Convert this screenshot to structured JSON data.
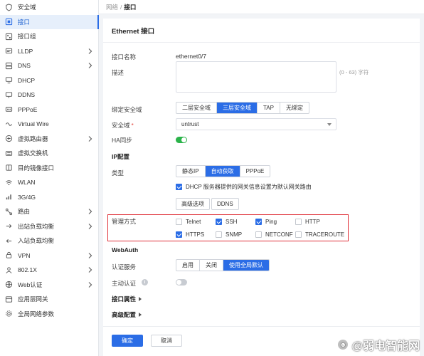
{
  "sidebar": {
    "items": [
      {
        "label": "安全域",
        "icon": "shield-icon",
        "has_children": false,
        "active": false
      },
      {
        "label": "接口",
        "icon": "interface-icon",
        "has_children": false,
        "active": true
      },
      {
        "label": "接口组",
        "icon": "interface-group-icon",
        "has_children": false,
        "active": false
      },
      {
        "label": "LLDP",
        "icon": "lldp-icon",
        "has_children": true,
        "active": false
      },
      {
        "label": "DNS",
        "icon": "dns-icon",
        "has_children": true,
        "active": false
      },
      {
        "label": "DHCP",
        "icon": "dhcp-icon",
        "has_children": false,
        "active": false
      },
      {
        "label": "DDNS",
        "icon": "ddns-icon",
        "has_children": false,
        "active": false
      },
      {
        "label": "PPPoE",
        "icon": "pppoe-icon",
        "has_children": false,
        "active": false
      },
      {
        "label": "Virtual Wire",
        "icon": "virtual-wire-icon",
        "has_children": false,
        "active": false
      },
      {
        "label": "虚拟路由器",
        "icon": "virtual-router-icon",
        "has_children": true,
        "active": false
      },
      {
        "label": "虚拟交换机",
        "icon": "virtual-switch-icon",
        "has_children": false,
        "active": false
      },
      {
        "label": "目的镜像接口",
        "icon": "mirror-icon",
        "has_children": false,
        "active": false
      },
      {
        "label": "WLAN",
        "icon": "wifi-icon",
        "has_children": false,
        "active": false
      },
      {
        "label": "3G/4G",
        "icon": "signal-icon",
        "has_children": false,
        "active": false
      },
      {
        "label": "路由",
        "icon": "route-icon",
        "has_children": true,
        "active": false
      },
      {
        "label": "出站负载均衡",
        "icon": "outbound-lb-icon",
        "has_children": true,
        "active": false
      },
      {
        "label": "入站负载均衡",
        "icon": "inbound-lb-icon",
        "has_children": false,
        "active": false
      },
      {
        "label": "VPN",
        "icon": "vpn-icon",
        "has_children": true,
        "active": false
      },
      {
        "label": "802.1X",
        "icon": "dot1x-icon",
        "has_children": true,
        "active": false
      },
      {
        "label": "Web认证",
        "icon": "web-auth-icon",
        "has_children": true,
        "active": false
      },
      {
        "label": "应用层网关",
        "icon": "gateway-icon",
        "has_children": false,
        "active": false
      },
      {
        "label": "全局网络参数",
        "icon": "gear-icon",
        "has_children": false,
        "active": false
      }
    ]
  },
  "breadcrumb": {
    "parent": "网络",
    "separator": "/",
    "current": "接口"
  },
  "card": {
    "title": "Ethernet 接口"
  },
  "form": {
    "name": {
      "label": "接口名称",
      "value": "ethernet0/7"
    },
    "description": {
      "label": "描述",
      "value": "",
      "hint": "(0 - 63) 字符"
    },
    "bind_zone": {
      "label": "绑定安全域",
      "options": [
        "二层安全域",
        "三层安全域",
        "TAP",
        "无绑定"
      ],
      "selected": 1
    },
    "zone": {
      "label": "安全域",
      "required_mark": "*",
      "value": "untrust"
    },
    "ha_sync": {
      "label": "HA同步",
      "enabled": true
    },
    "ip_section": "IP配置",
    "ip_type": {
      "label": "类型",
      "options": [
        "静态IP",
        "自动获取",
        "PPPoE"
      ],
      "selected": 1
    },
    "dhcp_gateway": {
      "label": "DHCP 服务器提供的网关信息设置为默认网关路由",
      "checked": true
    },
    "advanced_button": "高级选项",
    "ddns_button": "DDNS",
    "management": {
      "label": "管理方式",
      "options": [
        {
          "label": "Telnet",
          "checked": false
        },
        {
          "label": "SSH",
          "checked": true
        },
        {
          "label": "Ping",
          "checked": true
        },
        {
          "label": "HTTP",
          "checked": false
        },
        {
          "label": "HTTPS",
          "checked": true
        },
        {
          "label": "SNMP",
          "checked": false
        },
        {
          "label": "NETCONF",
          "checked": false
        },
        {
          "label": "TRACEROUTE",
          "checked": false
        }
      ]
    },
    "webauth_section": "WebAuth",
    "auth_service": {
      "label": "认证服务",
      "options": [
        "启用",
        "关闭",
        "使用全局默认"
      ],
      "selected": 2
    },
    "active_auth": {
      "label": "主动认证",
      "enabled": false,
      "info_icon": "i"
    },
    "interface_props": "接口属性",
    "advanced_config": "高级配置"
  },
  "footer": {
    "ok_label": "确定",
    "cancel_label": "取消"
  },
  "watermark": {
    "text": "@弱电智能网"
  },
  "colors": {
    "accent": "#2b6de6",
    "toggle_on": "#2bb34a",
    "highlight_box": "#e0323a"
  }
}
